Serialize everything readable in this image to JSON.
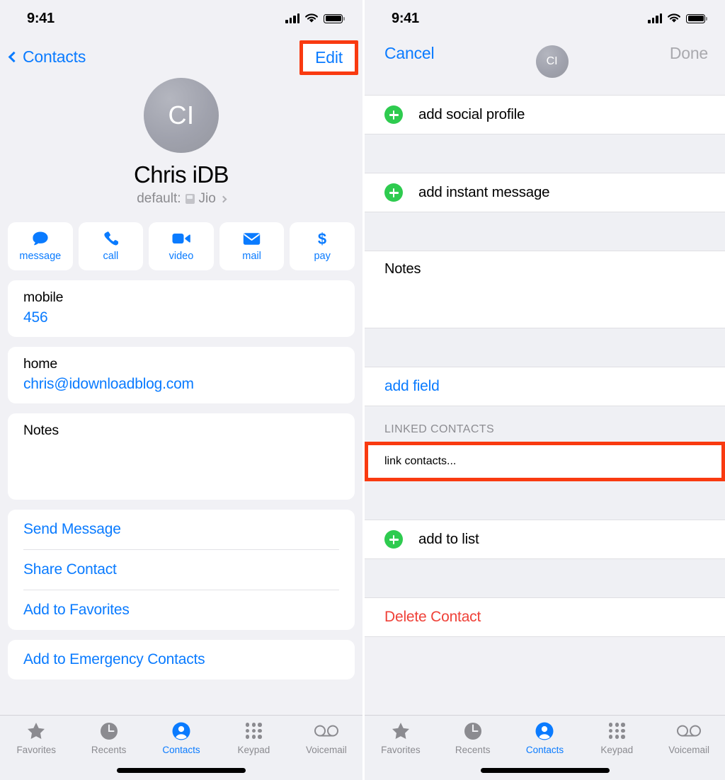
{
  "status_bar": {
    "time": "9:41",
    "signal_icon": "cellular-bars-icon",
    "wifi_icon": "wifi-icon",
    "battery_icon": "battery-full-icon"
  },
  "left_screen": {
    "nav": {
      "back_label": "Contacts",
      "back_icon": "chevron-left-icon",
      "edit_label": "Edit",
      "edit_highlight_color": "#f93a10"
    },
    "contact": {
      "initials": "CI",
      "name": "Chris iDB",
      "default_prefix": "default:",
      "default_line_label": "Jio",
      "sim_icon": "sim-card-icon",
      "disclosure_icon": "chevron-right-icon"
    },
    "quick_actions": [
      {
        "label": "message",
        "icon": "message-bubble-icon"
      },
      {
        "label": "call",
        "icon": "phone-handset-icon"
      },
      {
        "label": "video",
        "icon": "video-camera-icon"
      },
      {
        "label": "mail",
        "icon": "envelope-icon"
      },
      {
        "label": "pay",
        "icon": "dollar-sign-icon"
      }
    ],
    "fields": [
      {
        "label": "mobile",
        "value": "456"
      },
      {
        "label": "home",
        "value": "chris@idownloadblog.com"
      }
    ],
    "notes_label": "Notes",
    "notes_value": "",
    "link_actions": [
      "Send Message",
      "Share Contact",
      "Add to Favorites"
    ],
    "emergency_action": "Add to Emergency Contacts"
  },
  "right_screen": {
    "nav": {
      "cancel_label": "Cancel",
      "done_label": "Done",
      "initials": "CI"
    },
    "rows": {
      "add_social_profile": "add social profile",
      "add_instant_message": "add instant message",
      "notes_label": "Notes",
      "add_field": "add field",
      "linked_contacts_header": "LINKED CONTACTS",
      "link_contacts": "link contacts...",
      "add_to_list": "add to list",
      "delete_contact": "Delete Contact"
    },
    "highlight_color": "#f93a10",
    "plus_icon": "plus-circle-icon"
  },
  "tab_bar": {
    "items": [
      {
        "label": "Favorites",
        "icon": "star-icon",
        "active": false
      },
      {
        "label": "Recents",
        "icon": "clock-icon",
        "active": false
      },
      {
        "label": "Contacts",
        "icon": "person-circle-icon",
        "active": true
      },
      {
        "label": "Keypad",
        "icon": "keypad-grid-icon",
        "active": false
      },
      {
        "label": "Voicemail",
        "icon": "voicemail-icon",
        "active": false
      }
    ],
    "home_indicator": "home-indicator"
  },
  "colors": {
    "accent_blue": "#0a7bff",
    "green": "#2ecb4f",
    "red": "#ef4138",
    "highlight": "#f93a10",
    "bg": "#f1f1f5"
  }
}
